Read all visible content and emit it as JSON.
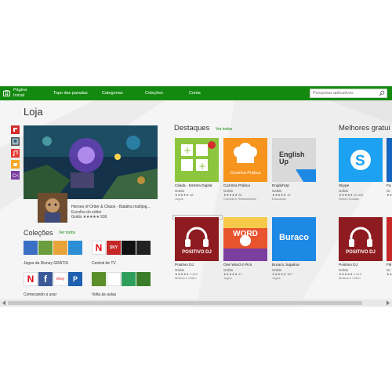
{
  "nav": {
    "home_label": "Página Inicial",
    "items": [
      "Topo das paradas",
      "Categorias",
      "Coleções",
      "Conta"
    ],
    "search_placeholder": "Pesquisar aplicativos"
  },
  "page_title": "Loja",
  "hero": {
    "title": "Heroes of Order & Chaos - Batalha multijog...",
    "subtitle": "Escolha do editor",
    "price": "Grátis",
    "stars": "★★★★★",
    "rating_count": "936"
  },
  "collections": {
    "title": "Coleções",
    "see_all": "Ver todos",
    "items": [
      {
        "label": "Jogos da Disney GRÁTIS"
      },
      {
        "label": "Central de TV"
      },
      {
        "label": "Começando a usar"
      },
      {
        "label": "Volta às aulas"
      }
    ],
    "tile_texts": {
      "netflix": "N",
      "sky": "SKY",
      "ebay": "ebay",
      "paypal": "P"
    }
  },
  "featured": {
    "title": "Destaques",
    "see_all": "Ver todos",
    "apps": [
      {
        "name": "Cilada - Estrela Digital",
        "price": "Grátis",
        "stars": "★★★★★",
        "count": "48",
        "category": "Jogos",
        "color": "#8cc63f"
      },
      {
        "name": "Cozinha Prática",
        "price": "Grátis",
        "stars": "★★★★★",
        "count": "26",
        "category": "Comida e Restaurantes",
        "color": "#f7941d",
        "icon_text": "Cozinha Prática"
      },
      {
        "name": "EnglishUp",
        "price": "Grátis",
        "stars": "★★★★★",
        "count": "10",
        "category": "Educação",
        "color": "#d9d9d9",
        "icon_text": "English Up"
      },
      {
        "name": "Positivo DJ",
        "price": "Grátis",
        "stars": "★★★★★",
        "count": "1.212",
        "category": "Música e Vídeo",
        "color": "#c1272d",
        "icon_text": "POSITIVO DJ"
      },
      {
        "name": "One Word 4 Pics",
        "price": "Grátis",
        "stars": "★★★★★",
        "count": "37",
        "category": "Jogos",
        "color": "#e8542e",
        "icon_text": "WORD"
      },
      {
        "name": "Buraco Jogatina",
        "price": "Grátis",
        "stars": "★★★★★",
        "count": "187",
        "category": "Jogos",
        "color": "#1e88e5",
        "icon_text": "Buraco"
      }
    ]
  },
  "best_free": {
    "title": "Melhores gratui",
    "apps": [
      {
        "name": "Skype",
        "price": "Grátis",
        "stars": "★★★★★",
        "count": "10.424",
        "category": "Redes Sociais",
        "color": "#1da1f2"
      },
      {
        "name": "Positivo DJ",
        "price": "Grátis",
        "stars": "★★★★★",
        "count": "1.212",
        "category": "Música e Vídeo",
        "color": "#c1272d",
        "icon_text": "POSITIVO DJ"
      }
    ],
    "partial": [
      {
        "name": "Fa",
        "price": "Gr",
        "count": "★★"
      },
      {
        "name": "Filr",
        "price": "Gr",
        "count": "★★"
      }
    ]
  },
  "colors": {
    "accent": "#138a0f",
    "link": "#138a0f"
  }
}
